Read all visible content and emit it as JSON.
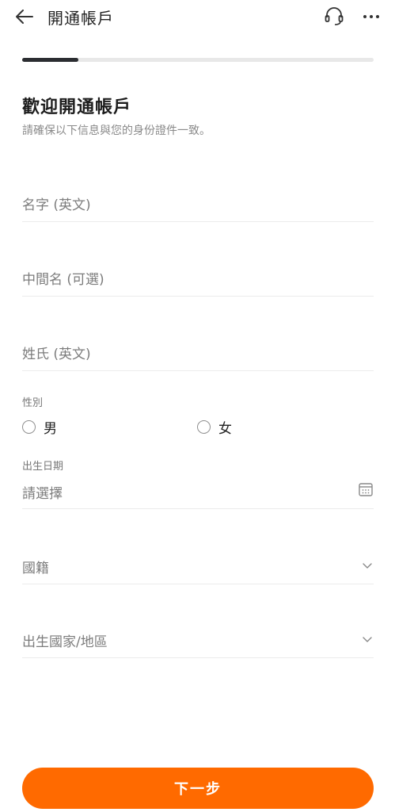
{
  "header": {
    "title": "開通帳戶",
    "icons": [
      "back-arrow-icon",
      "headset-icon",
      "more-dots-icon"
    ]
  },
  "progress": {
    "value": 0.16
  },
  "intro": {
    "heading": "歡迎開通帳戶",
    "subheading": "請確保以下信息與您的身份證件一致。"
  },
  "form": {
    "first_name": {
      "placeholder": "名字 (英文)"
    },
    "middle_name": {
      "placeholder": "中間名 (可選)"
    },
    "last_name": {
      "placeholder": "姓氏 (英文)"
    },
    "gender": {
      "label": "性別",
      "options": [
        "男",
        "女"
      ]
    },
    "birth_date": {
      "label": "出生日期",
      "placeholder": "請選擇"
    },
    "nationality": {
      "placeholder": "國籍"
    },
    "birth_country": {
      "placeholder": "出生國家/地區"
    }
  },
  "actions": {
    "next_label": "下一步"
  },
  "colors": {
    "accent": "#ff6a00",
    "progress_fill": "#2b2d31",
    "track": "#e8e8e8"
  }
}
